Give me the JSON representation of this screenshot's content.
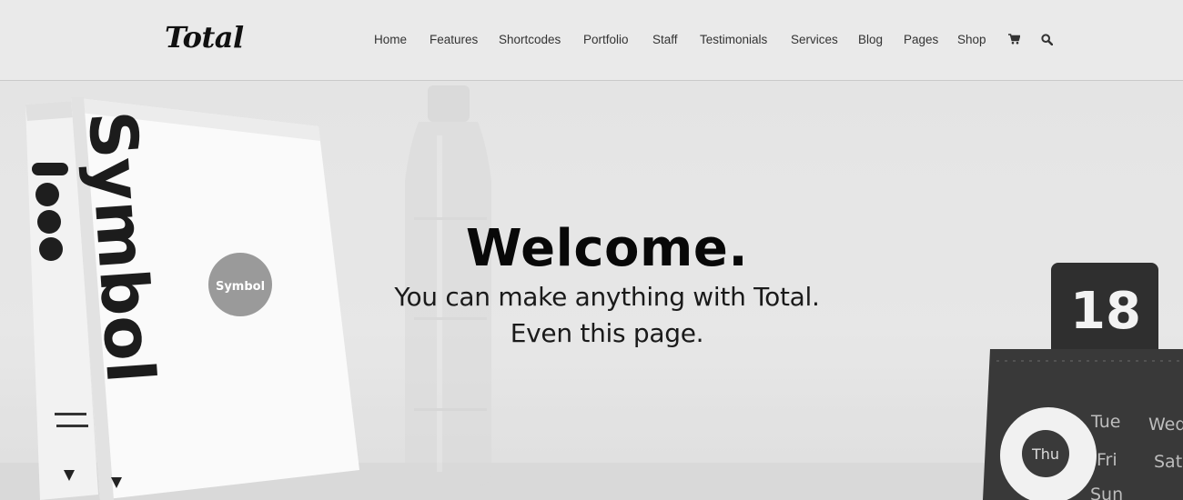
{
  "header": {
    "logo": "Total",
    "nav": [
      {
        "label": "Home"
      },
      {
        "label": "Features"
      },
      {
        "label": "Shortcodes"
      },
      {
        "label": "Portfolio"
      },
      {
        "label": "Staff"
      },
      {
        "label": "Testimonials"
      },
      {
        "label": "Services"
      },
      {
        "label": "Blog"
      },
      {
        "label": "Pages"
      },
      {
        "label": "Shop"
      }
    ],
    "icons": [
      "cart-icon",
      "search-icon"
    ]
  },
  "hero": {
    "title": "Welcome.",
    "line1": "You can make anything with Total.",
    "line2": "Even this page.",
    "book_spine_text": "Symbol",
    "book_sticker": "Symbol",
    "calendar_date": "18",
    "calendar_days": [
      "Tue",
      "Wed",
      "Fri",
      "Sat",
      "Sun"
    ],
    "calendar_selected_day": "Thu"
  },
  "colors": {
    "header_bg": "#e9e9e9",
    "text_dark": "#111111",
    "nav_text": "#333333"
  }
}
